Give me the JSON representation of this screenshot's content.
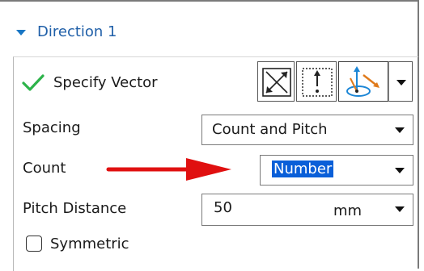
{
  "group": {
    "title": "Direction 1"
  },
  "specify_vector": {
    "label": "Specify Vector",
    "status_icon": "green-checkmark",
    "buttons": [
      "vector-dialog-icon",
      "inferred-vector-icon",
      "vector-constructor-icon"
    ],
    "dropdown_icon": "chevron-down-icon"
  },
  "spacing": {
    "label": "Spacing",
    "value": "Count and Pitch"
  },
  "count": {
    "label": "Count",
    "value": "Number",
    "selected": true
  },
  "pitch_distance": {
    "label": "Pitch Distance",
    "value": "50",
    "unit": "mm"
  },
  "symmetric": {
    "label": "Symmetric",
    "checked": false
  },
  "colors": {
    "accent": "#1f5fa8",
    "check": "#2db34a",
    "selection": "#0a5fd8",
    "annotation_arrow": "#e01010"
  }
}
